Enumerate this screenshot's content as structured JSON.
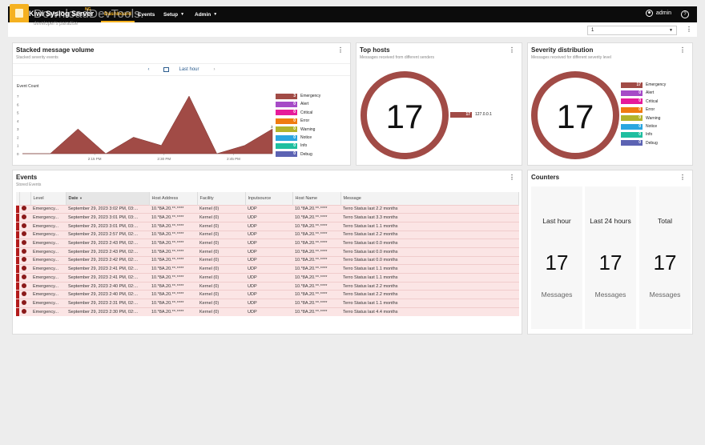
{
  "app": {
    "title": "Kiwi Syslog Server",
    "badge": "NG",
    "watermark": "DownloadDevTools.",
    "watermark_sub": "developer's paradise"
  },
  "nav": {
    "dashboard": "Dashboard",
    "events": "Events",
    "setup": "Setup",
    "admin": "Admin"
  },
  "user": {
    "name": "admin",
    "help": "?"
  },
  "selector": {
    "value": "1"
  },
  "volume": {
    "title": "Stacked message volume",
    "subtitle": "Stacked severity events",
    "range": "Last hour",
    "nav_prev": "‹",
    "nav_next": "›"
  },
  "chart_data": {
    "type": "area",
    "ylabel": "Event Count",
    "ylim": [
      0,
      7
    ],
    "yticks": [
      "0",
      "1",
      "2",
      "3",
      "4",
      "5",
      "6",
      "7"
    ],
    "xticks": [
      "2:15 PM",
      "2:30 PM",
      "2:45 PM"
    ],
    "x": [
      0,
      1,
      2,
      3,
      4,
      5,
      6,
      7,
      8,
      9
    ],
    "series": [
      {
        "name": "Emergency",
        "values": [
          0,
          0,
          3,
          0,
          2,
          1,
          7,
          0,
          1,
          3
        ]
      }
    ],
    "annotation": "3",
    "color": "#a14b46"
  },
  "severity_levels": [
    {
      "name": "Emergency",
      "count": "17",
      "color": "#a14b46"
    },
    {
      "name": "Alert",
      "count": "0",
      "color": "#a64bc7"
    },
    {
      "name": "Critical",
      "count": "0",
      "color": "#e61a9a"
    },
    {
      "name": "Error",
      "count": "0",
      "color": "#f07b10"
    },
    {
      "name": "Warning",
      "count": "0",
      "color": "#b3b32b"
    },
    {
      "name": "Notice",
      "count": "0",
      "color": "#2aa6e0"
    },
    {
      "name": "Info",
      "count": "0",
      "color": "#1fbfa0"
    },
    {
      "name": "Debug",
      "count": "0",
      "color": "#5c63b3"
    }
  ],
  "volume_legend": [
    {
      "name": "Emergency",
      "count": "3"
    },
    {
      "name": "Alert",
      "count": "0"
    },
    {
      "name": "Critical",
      "count": "0"
    },
    {
      "name": "Error",
      "count": "0"
    },
    {
      "name": "Warning",
      "count": "0"
    },
    {
      "name": "Notice",
      "count": "0"
    },
    {
      "name": "Info",
      "count": "0"
    },
    {
      "name": "Debug",
      "count": "0"
    }
  ],
  "top_hosts": {
    "title": "Top hosts",
    "subtitle": "Messages received from different senders",
    "total": "17",
    "host": {
      "count": "17",
      "name": "127.0.0.1"
    }
  },
  "severity": {
    "title": "Severity distribution",
    "subtitle": "Messages received for different severity level",
    "total": "17"
  },
  "events": {
    "title": "Events",
    "subtitle": "Stored Events",
    "columns": [
      "Level",
      "Date",
      "Host Address",
      "Facility",
      "Inputsource",
      "Host Name",
      "Message"
    ],
    "sort_indicator": "▼",
    "rows": [
      [
        "Emergency...",
        "September 29, 2023 3:02 PM, 03:...",
        "10.*8A.20.**·****",
        "Kernel (0)",
        "UDP",
        "10.*8A.20.**·****",
        "Terro Status last 2.2 months"
      ],
      [
        "Emergency...",
        "September 29, 2023 3:01 PM, 03:...",
        "10.*8A.20.**·****",
        "Kernel (0)",
        "UDP",
        "10.*8A.20.**·****",
        "Terro Status last 3.3 months"
      ],
      [
        "Emergency...",
        "September 29, 2023 3:01 PM, 03:...",
        "10.*8A.20.**·****",
        "Kernel (0)",
        "UDP",
        "10.*8A.20.**·****",
        "Terro Status last 1.1 months"
      ],
      [
        "Emergency...",
        "September 29, 2023 2:57 PM, 02:...",
        "10.*8A.20.**·****",
        "Kernel (0)",
        "UDP",
        "10.*8A.20.**·****",
        "Terro Status last 2.2 months"
      ],
      [
        "Emergency...",
        "September 29, 2023 2:43 PM, 02:...",
        "10.*8A.20.**·****",
        "Kernel (0)",
        "UDP",
        "10.*8A.20.**·****",
        "Terro Status last 0.0 months"
      ],
      [
        "Emergency...",
        "September 29, 2023 2:43 PM, 02:...",
        "10.*8A.20.**·****",
        "Kernel (0)",
        "UDP",
        "10.*8A.20.**·****",
        "Terro Status last 0.0 months"
      ],
      [
        "Emergency...",
        "September 29, 2023 2:42 PM, 02:...",
        "10.*8A.20.**·****",
        "Kernel (0)",
        "UDP",
        "10.*8A.20.**·****",
        "Terro Status last 0.0 months"
      ],
      [
        "Emergency...",
        "September 29, 2023 2:41 PM, 02:...",
        "10.*8A.20.**·****",
        "Kernel (0)",
        "UDP",
        "10.*8A.20.**·****",
        "Terro Status last 1.1 months"
      ],
      [
        "Emergency...",
        "September 29, 2023 2:41 PM, 02:...",
        "10.*8A.20.**·****",
        "Kernel (0)",
        "UDP",
        "10.*8A.20.**·****",
        "Terro Status last 1.1 months"
      ],
      [
        "Emergency...",
        "September 29, 2023 2:40 PM, 02:...",
        "10.*8A.20.**·****",
        "Kernel (0)",
        "UDP",
        "10.*8A.20.**·****",
        "Terro Status last 2.2 months"
      ],
      [
        "Emergency...",
        "September 29, 2023 2:40 PM, 02:...",
        "10.*8A.20.**·****",
        "Kernel (0)",
        "UDP",
        "10.*8A.20.**·****",
        "Terro Status last 2.2 months"
      ],
      [
        "Emergency...",
        "September 29, 2023 2:31 PM, 02:...",
        "10.*8A.20.**·****",
        "Kernel (0)",
        "UDP",
        "10.*8A.20.**·****",
        "Terro Status last 1.1 months"
      ],
      [
        "Emergency...",
        "September 29, 2023 2:30 PM, 02:...",
        "10.*8A.20.**·****",
        "Kernel (0)",
        "UDP",
        "10.*8A.20.**·****",
        "Terro Status last 4.4 months"
      ]
    ]
  },
  "counters": {
    "title": "Counters",
    "items": [
      {
        "label": "Last hour",
        "value": "17",
        "unit": "Messages"
      },
      {
        "label": "Last 24 hours",
        "value": "17",
        "unit": "Messages"
      },
      {
        "label": "Total",
        "value": "17",
        "unit": "Messages"
      }
    ]
  },
  "kebab": "⋮"
}
